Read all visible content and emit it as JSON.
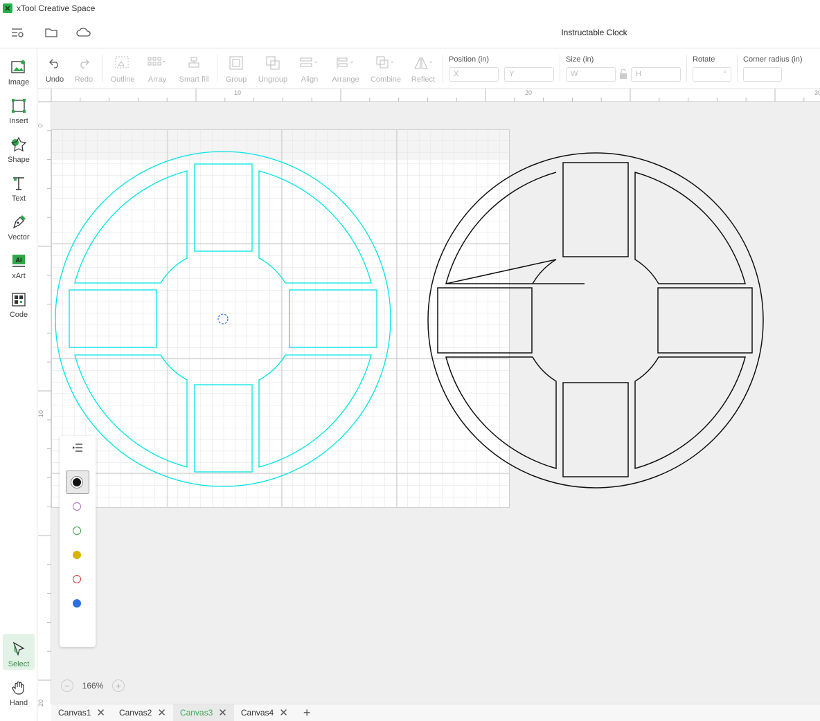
{
  "window": {
    "app_name": "xTool Creative Space"
  },
  "header": {
    "document_title": "Instructable Clock"
  },
  "left_tools": [
    {
      "label": "Image",
      "icon": "image-icon"
    },
    {
      "label": "Insert",
      "icon": "insert-icon"
    },
    {
      "label": "Shape",
      "icon": "shape-icon"
    },
    {
      "label": "Text",
      "icon": "text-icon"
    },
    {
      "label": "Vector",
      "icon": "vector-pen-icon"
    },
    {
      "label": "xArt",
      "icon": "xart-ai-icon",
      "badge": "AI"
    },
    {
      "label": "Code",
      "icon": "qr-code-icon"
    }
  ],
  "mode_tools": [
    {
      "label": "Select",
      "icon": "select-cursor-icon",
      "active": true
    },
    {
      "label": "Hand",
      "icon": "hand-icon",
      "active": false
    }
  ],
  "toolbar": {
    "undo": "Undo",
    "redo": "Redo",
    "outline": "Outline",
    "array": "Array",
    "smart_fill": "Smart fill",
    "group": "Group",
    "ungroup": "Ungroup",
    "align": "Align",
    "arrange": "Arrange",
    "combine": "Combine",
    "reflect": "Reflect",
    "position_label": "Position (in)",
    "x_placeholder": "X",
    "y_placeholder": "Y",
    "size_label": "Size (in)",
    "w_placeholder": "W",
    "h_placeholder": "H",
    "rotate_label": "Rotate",
    "rotate_unit": "°",
    "corner_label": "Corner radius (in)"
  },
  "rulers": {
    "top": [
      "10",
      "20",
      "30"
    ],
    "left": [
      "0",
      "10",
      "20"
    ]
  },
  "layers": {
    "colors": [
      "#111111",
      "#b070c8",
      "#3aa04a",
      "#d8b400",
      "#d83a3a",
      "#2d6fe0"
    ]
  },
  "zoom": {
    "level": "166%",
    "minus": "−",
    "plus": "+"
  },
  "tabs": [
    {
      "label": "Canvas1",
      "active": false
    },
    {
      "label": "Canvas2",
      "active": false
    },
    {
      "label": "Canvas3",
      "active": true
    },
    {
      "label": "Canvas4",
      "active": false
    }
  ],
  "tab_close": "✕",
  "tab_add": "+",
  "accent": "#46a85a",
  "design_colors": {
    "preview": "#00e5e5",
    "object": "#111111"
  }
}
